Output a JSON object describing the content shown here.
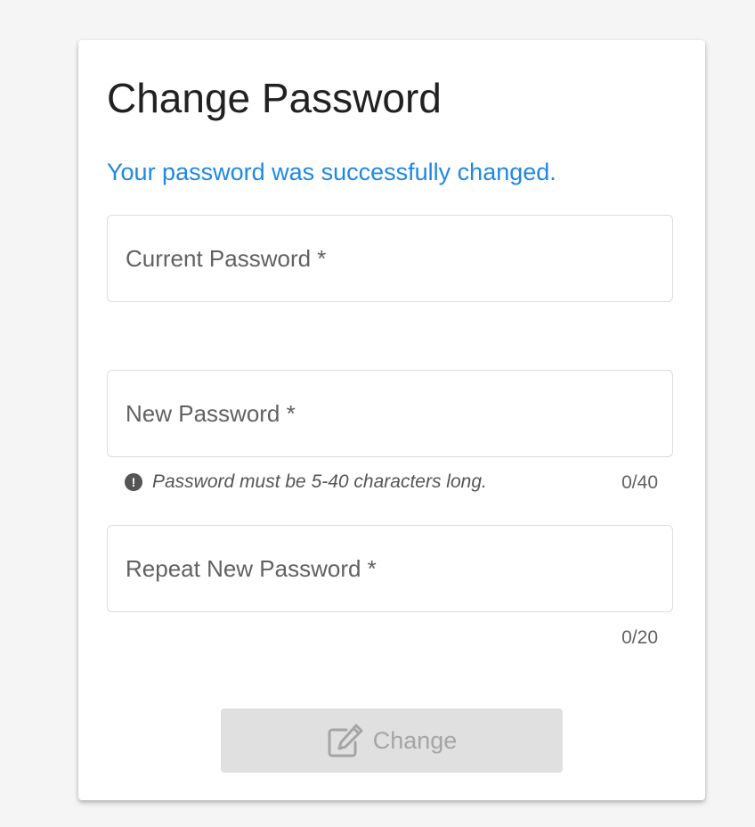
{
  "card": {
    "title": "Change Password",
    "success_message": "Your password was successfully changed."
  },
  "fields": {
    "current": {
      "label": "Current Password *"
    },
    "new": {
      "label": "New Password *",
      "hint": "Password must be 5-40 characters long.",
      "hint_icon": "info-icon",
      "counter": "0/40"
    },
    "repeat": {
      "label": "Repeat New Password *",
      "counter": "0/20"
    }
  },
  "button": {
    "label": "Change",
    "icon": "edit-icon",
    "disabled": true
  },
  "colors": {
    "success": "#1e88e5",
    "button_bg": "#e0e0e0",
    "button_text": "#a5a5a5"
  }
}
